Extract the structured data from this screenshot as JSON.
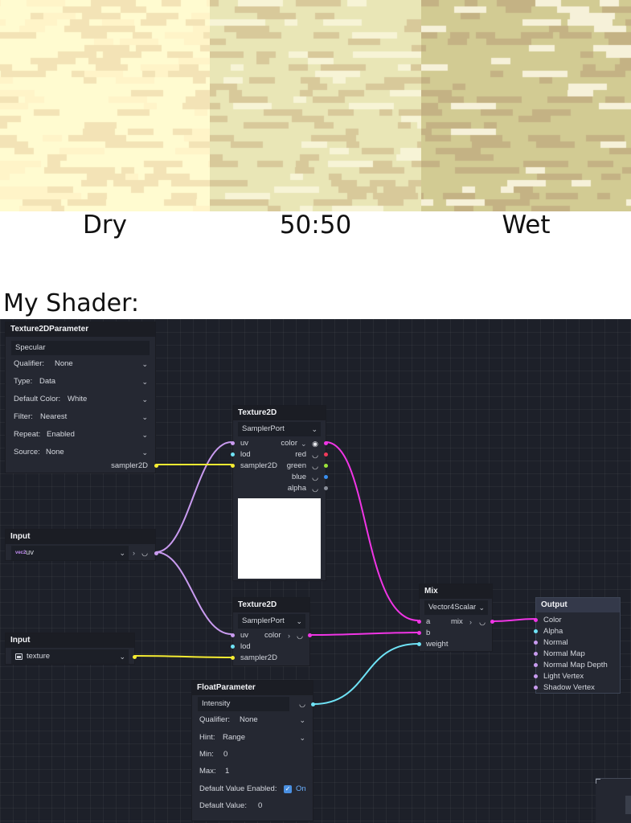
{
  "swatches": [
    {
      "label": "Dry",
      "base": "#fffbd0",
      "dark": "#f3e3b6",
      "light": "#fff4c8"
    },
    {
      "label": "50:50",
      "base": "#e9e6b6",
      "dark": "#d8c99a",
      "light": "#f7f4d6"
    },
    {
      "label": "Wet",
      "base": "#d2cb93",
      "dark": "#c4b284",
      "light": "#f6f1d9"
    }
  ],
  "heading": "My Shader:",
  "colors": {
    "uv_wire": "#c99bf0",
    "sampler_wire": "#f5ec32",
    "color_wire": "#f035e5",
    "float_wire": "#6fe3f6",
    "graph_bg": "#1d2029"
  },
  "texture_param": {
    "title": "Texture2DParameter",
    "name_value": "Specular",
    "qualifier_label": "Qualifier:",
    "qualifier_value": "None",
    "type_label": "Type:",
    "type_value": "Data",
    "default_color_label": "Default Color:",
    "default_color_value": "White",
    "filter_label": "Filter:",
    "filter_value": "Nearest",
    "repeat_label": "Repeat:",
    "repeat_value": "Enabled",
    "source_label": "Source:",
    "source_value": "None",
    "output_label": "sampler2D"
  },
  "input_uv": {
    "title": "Input",
    "value": "uv",
    "badge": "vec2"
  },
  "input_texture": {
    "title": "Input",
    "value": "texture",
    "icon": "image-icon"
  },
  "texture_top": {
    "title": "Texture2D",
    "sampler_value": "SamplerPort",
    "in_uv": "uv",
    "in_lod": "lod",
    "in_sampler": "sampler2D",
    "out_color": "color",
    "out_red": "red",
    "out_green": "green",
    "out_blue": "blue",
    "out_alpha": "alpha"
  },
  "texture_bottom": {
    "title": "Texture2D",
    "sampler_value": "SamplerPort",
    "in_uv": "uv",
    "in_lod": "lod",
    "in_sampler": "sampler2D",
    "out_color": "color"
  },
  "mix": {
    "title": "Mix",
    "mode_value": "Vector4Scalar",
    "in_a": "a",
    "in_b": "b",
    "in_weight": "weight",
    "out_mix": "mix"
  },
  "output": {
    "title": "Output",
    "inputs": [
      "Color",
      "Alpha",
      "Normal",
      "Normal Map",
      "Normal Map Depth",
      "Light Vertex",
      "Shadow Vertex"
    ]
  },
  "float_param": {
    "title": "FloatParameter",
    "name_value": "Intensity",
    "qualifier_label": "Qualifier:",
    "qualifier_value": "None",
    "hint_label": "Hint:",
    "hint_value": "Range",
    "min_label": "Min:",
    "min_value": "0",
    "max_label": "Max:",
    "max_value": "1",
    "default_enabled_label": "Default Value Enabled:",
    "default_enabled_value": "On",
    "default_value_label": "Default Value:",
    "default_value": "0"
  }
}
